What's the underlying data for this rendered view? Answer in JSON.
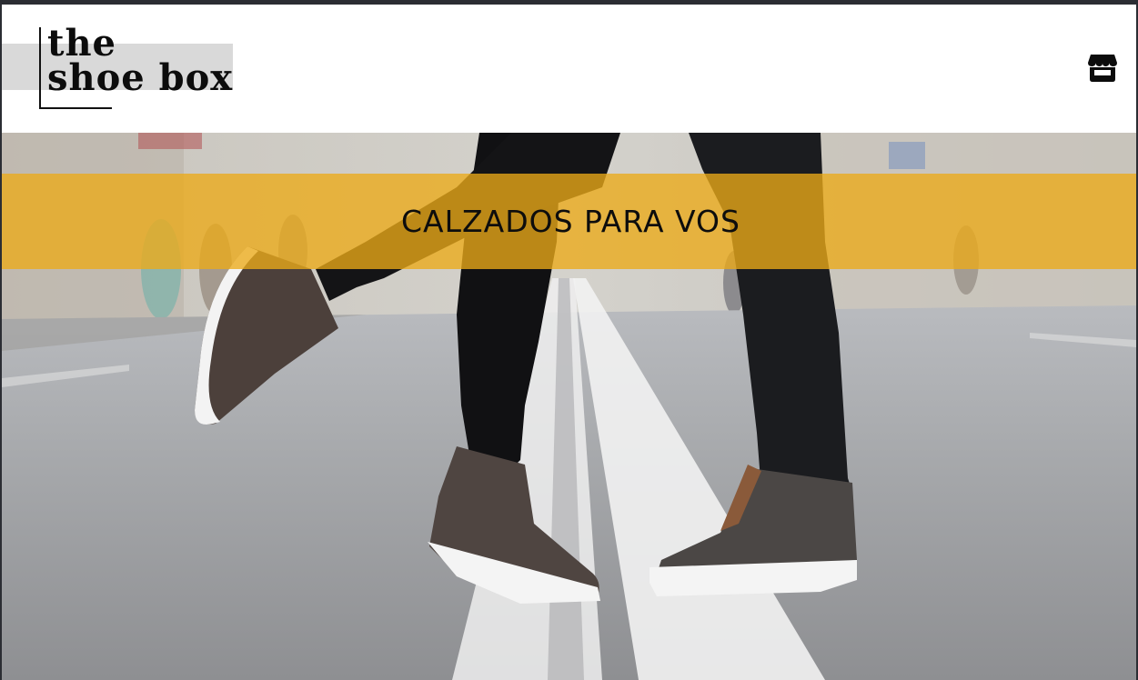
{
  "header": {
    "logo": {
      "line1": "the",
      "line2": "shoe box"
    },
    "store_icon": "store-icon"
  },
  "hero": {
    "banner_text": "CALZADOS PARA VOS",
    "banner_color": "#ECAA18",
    "image": "hero-photo-couple-shoes-street"
  }
}
